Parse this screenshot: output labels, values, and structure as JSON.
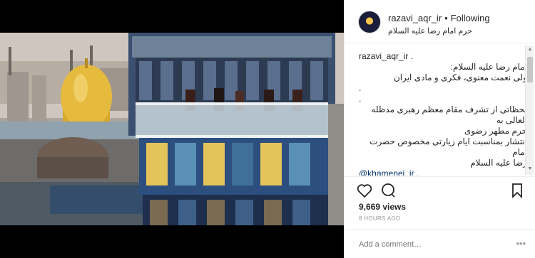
{
  "header": {
    "username": "razavi_aqr_ir",
    "separator": "•",
    "follow_label": "Following",
    "location": "حرم امام رضا علیه السلام"
  },
  "caption": {
    "username": "razavi_aqr_ir",
    "tail": ".",
    "lines": [
      "امام رضا علیه السلام:",
      "ولی نعمت معنوی، فکری و مادی ایران",
      ".",
      ".",
      "لحظاتی از تشرف مقام معظم رهبری مدظله العالی به",
      "حرم مطهر رضوی",
      "انتشار بمناسبت ایام زیارتی مخصوص حضرت امام",
      "رضا علیه السلام"
    ],
    "mention": "@khamenei_ir",
    "mention_tail": ".",
    "trailing": [
      "."
    ]
  },
  "stats": {
    "views": "9,669 views",
    "time_ago": "8 HOURS AGO"
  },
  "comment": {
    "placeholder": "Add a comment…",
    "more": "•••"
  },
  "icons": {
    "like": "heart-icon",
    "comment": "comment-icon",
    "save": "bookmark-icon"
  },
  "colors": {
    "text": "#262626",
    "muted": "#999999",
    "border": "#efefef",
    "dome_gold": "#e0b437",
    "tile_blue": "#2a4f7e"
  }
}
